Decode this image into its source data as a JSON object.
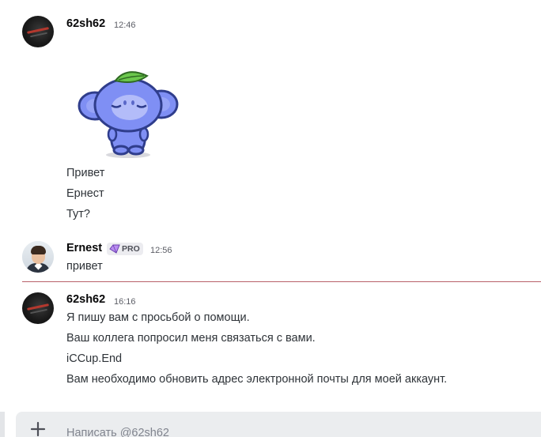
{
  "messages": [
    {
      "author": "62sh62",
      "time": "12:46",
      "lines": [
        "Привет",
        "Ернест",
        "Тут?"
      ],
      "sticker": "wumpus-sticker"
    },
    {
      "author": "Ernest",
      "badge": "PRO",
      "time": "12:56",
      "lines": [
        "привет"
      ]
    },
    {
      "author": "62sh62",
      "time": "16:16",
      "lines": [
        "Я пишу вам с просьбой о помощи.",
        "Ваш коллега попросил меня связаться с вами.",
        "iCCup.End",
        "Вам необходимо обновить адрес электронной почты для моей аккаунт."
      ]
    }
  ],
  "composer": {
    "placeholder": "Написать @62sh62",
    "add_icon": "plus-icon"
  },
  "colors": {
    "unread_divider": "#b8616a",
    "pro_badge_gem": "#b98cf0",
    "wumpus_body": "#7f8ff4",
    "leaf": "#6cc84d"
  }
}
